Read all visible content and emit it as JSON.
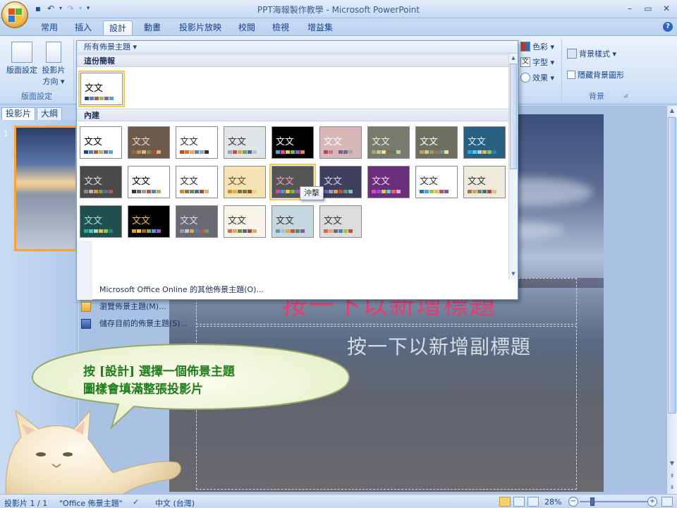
{
  "window": {
    "title": "PPT海報製作教學 - Microsoft PowerPoint",
    "controls": [
      "–",
      "▭",
      "✕"
    ]
  },
  "ribbon_tabs": [
    {
      "label": "常用",
      "active": false
    },
    {
      "label": "插入",
      "active": false
    },
    {
      "label": "設計",
      "active": true
    },
    {
      "label": "動畫",
      "active": false
    },
    {
      "label": "投影片放映",
      "active": false
    },
    {
      "label": "校閱",
      "active": false
    },
    {
      "label": "檢視",
      "active": false
    },
    {
      "label": "增益集",
      "active": false
    }
  ],
  "ribbon": {
    "page_setup_group": {
      "label": "版面設定",
      "page_setup_btn": "版面設定",
      "orientation_btn": "投影片\n方向",
      "orientation_l1": "投影片",
      "orientation_l2": "方向 ▾"
    },
    "themes_group": {
      "colors": "色彩 ▾",
      "fonts": "字型 ▾",
      "effects": "效果 ▾"
    },
    "background_group": {
      "label": "背景",
      "bg_styles": "背景樣式 ▾",
      "hide_bg": "隱藏背景圖形"
    }
  },
  "left_pane": {
    "tabs": [
      "投影片",
      "大綱"
    ],
    "slide_number": "1"
  },
  "gallery": {
    "header": "所有佈景主題 ▾",
    "section_this": "這份簡報",
    "section_builtin": "內建",
    "tooltip": "沖擊",
    "thumb_text": "文文",
    "menu": [
      {
        "label": "Microsoft Office Online 的其他佈景主題(O)...",
        "icon": "none"
      },
      {
        "label": "瀏覽佈景主題(M)...",
        "icon": "folder-icon"
      },
      {
        "label": "儲存目前的佈景主題(S)...",
        "icon": "save-theme-icon"
      }
    ]
  },
  "slide": {
    "title_placeholder": "按一下以新增標題",
    "subtitle_placeholder": "按一下以新增副標題"
  },
  "callout": {
    "line1": "按 [設計] 選擇一個佈景主題",
    "line2": "圖樣會填滿整張投影片"
  },
  "status_bar": {
    "slide_info": "投影片 1 / 1",
    "theme_name": "\"Office 佈景主題\"",
    "language": "中文 (台灣)",
    "zoom": "28%",
    "zoom_minus": "−",
    "zoom_plus": "+"
  },
  "colors": {
    "accent_orange": "#f3a43a",
    "title_pink": "#e53d73",
    "callout_green": "#207d1c",
    "ribbon_blue": "#15428b"
  }
}
